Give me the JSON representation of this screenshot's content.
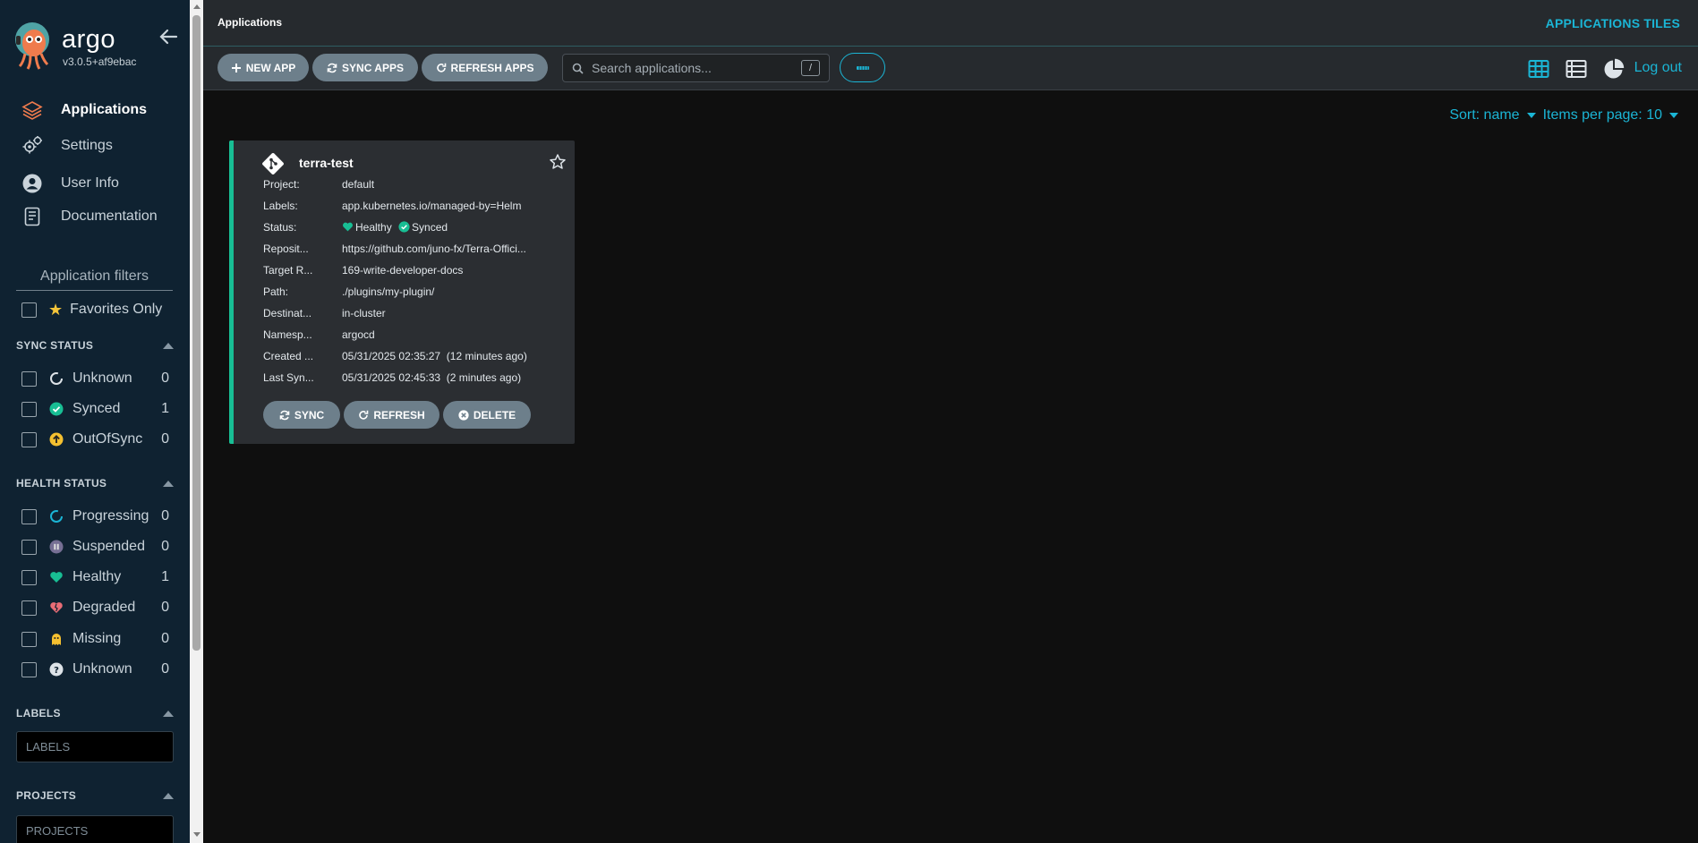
{
  "sidebar": {
    "brand": "argo",
    "version": "v3.0.5+af9ebac",
    "nav": [
      {
        "label": "Applications"
      },
      {
        "label": "Settings"
      },
      {
        "label": "User Info"
      },
      {
        "label": "Documentation"
      }
    ],
    "filters_title": "Application filters",
    "favorites_label": "Favorites Only",
    "sync_status": {
      "title": "SYNC STATUS",
      "items": [
        {
          "label": "Unknown",
          "count": "0"
        },
        {
          "label": "Synced",
          "count": "1"
        },
        {
          "label": "OutOfSync",
          "count": "0"
        }
      ]
    },
    "health_status": {
      "title": "HEALTH STATUS",
      "items": [
        {
          "label": "Progressing",
          "count": "0"
        },
        {
          "label": "Suspended",
          "count": "0"
        },
        {
          "label": "Healthy",
          "count": "1"
        },
        {
          "label": "Degraded",
          "count": "0"
        },
        {
          "label": "Missing",
          "count": "0"
        },
        {
          "label": "Unknown",
          "count": "0"
        }
      ]
    },
    "labels": {
      "title": "LABELS",
      "placeholder": "LABELS"
    },
    "projects": {
      "title": "PROJECTS",
      "placeholder": "PROJECTS"
    }
  },
  "topbar": {
    "breadcrumb": "Applications",
    "view_title": "APPLICATIONS TILES"
  },
  "toolbar": {
    "new_app": "NEW APP",
    "sync_apps": "SYNC APPS",
    "refresh_apps": "REFRESH APPS",
    "search_placeholder": "Search applications...",
    "search_shortcut": "/",
    "logout": "Log out"
  },
  "sort": {
    "sort_label": "Sort: name",
    "items_label": "Items per page: 10"
  },
  "app_card": {
    "name": "terra-test",
    "fields": [
      {
        "key": "Project:",
        "value": "default"
      },
      {
        "key": "Labels:",
        "value": "app.kubernetes.io/managed-by=Helm"
      },
      {
        "key": "Status:",
        "health": "Healthy",
        "sync": "Synced"
      },
      {
        "key": "Reposit...",
        "value": "https://github.com/juno-fx/Terra-Offici..."
      },
      {
        "key": "Target R...",
        "value": "169-write-developer-docs"
      },
      {
        "key": "Path:",
        "value": "./plugins/my-plugin/"
      },
      {
        "key": "Destinat...",
        "value": "in-cluster"
      },
      {
        "key": "Namesp...",
        "value": "argocd"
      },
      {
        "key": "Created ...",
        "value": "05/31/2025 02:35:27  (12 minutes ago)"
      },
      {
        "key": "Last Syn...",
        "value": "05/31/2025 02:45:33  (2 minutes ago)"
      }
    ],
    "buttons": {
      "sync": "SYNC",
      "refresh": "REFRESH",
      "delete": "DELETE"
    }
  },
  "colors": {
    "accent": "#1bb5d5",
    "healthy": "#18be94",
    "out_of_sync": "#f4c030",
    "degraded": "#e96d76",
    "sidebar_bg": "#0f2231"
  }
}
